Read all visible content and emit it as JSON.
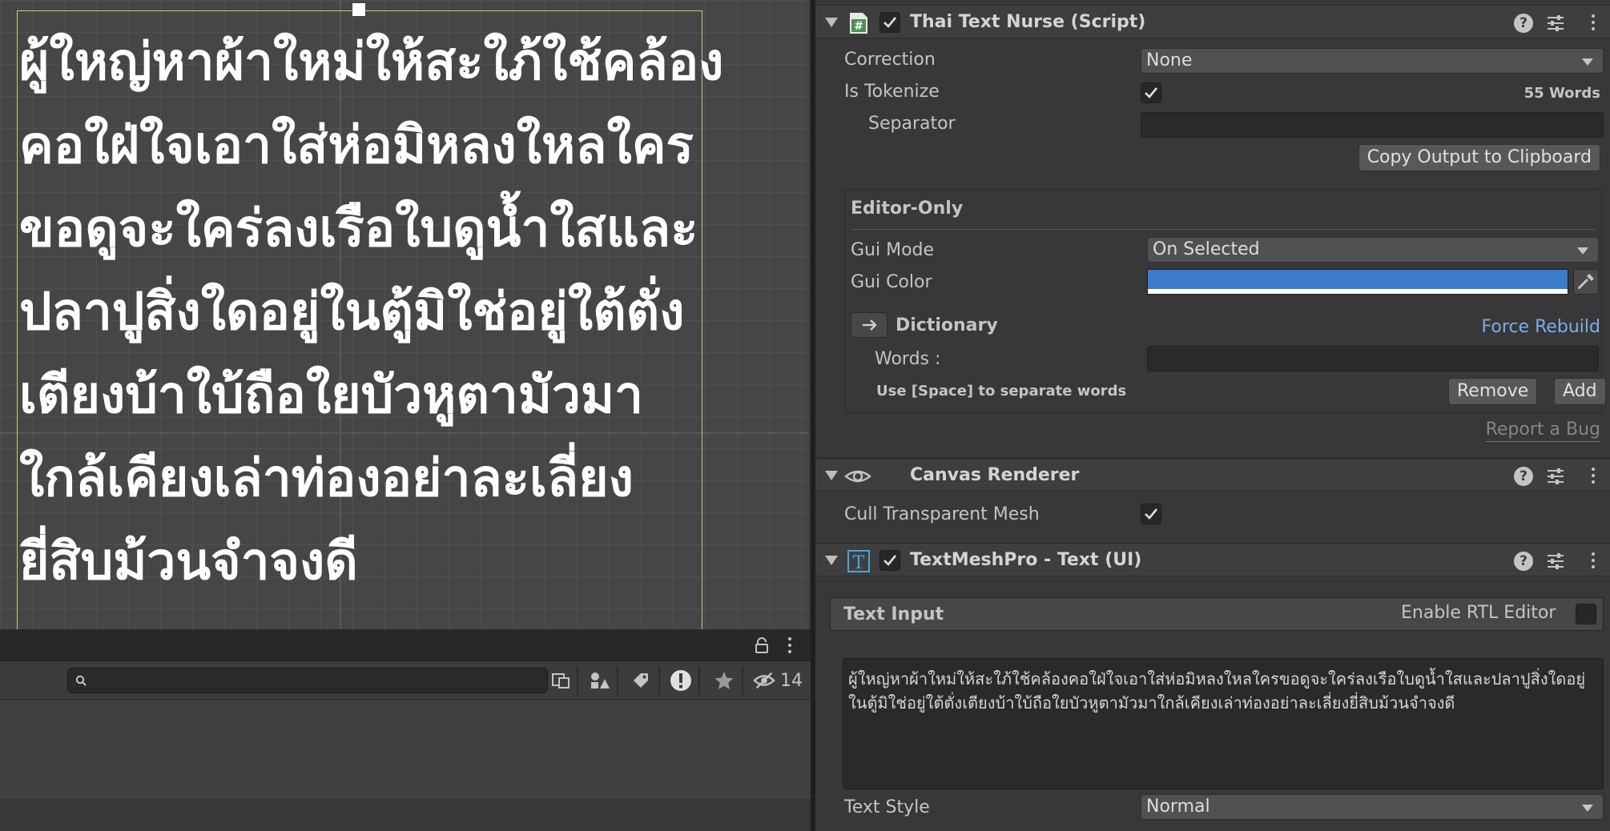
{
  "scene": {
    "text_lines": [
      "ผู้ใหญ่หาผ้าใหม่ให้สะใภ้ใช้คล้อง",
      "คอใฝ่ใจเอาใส่ห่อมิหลงใหลใคร",
      "ขอดูจะใคร่ลงเรือใบดูน้ำใสและ",
      "ปลาปูสิ่งใดอยู่ในตู้มิใช่อยู่ใต้ตั่ง",
      "เตียงบ้าใบ้ถือใยบัวหูตามัวมา",
      "ใกล้เคียงเล่าท่องอย่าละเลี่ยง",
      "ยี่สิบม้วนจำจงดี"
    ]
  },
  "project_pane": {
    "search": {
      "value": "",
      "placeholder": ""
    },
    "hidden_count": "14"
  },
  "inspector": {
    "thai_text_nurse": {
      "title": "Thai Text Nurse (Script)",
      "enabled": true,
      "correction_label": "Correction",
      "correction_value": "None",
      "is_tokenize_label": "Is Tokenize",
      "is_tokenize": true,
      "word_count": "55 Words",
      "separator_label": "Separator",
      "separator_value": "",
      "copy_button": "Copy Output to Clipboard",
      "editor_only": {
        "title": "Editor-Only",
        "gui_mode_label": "Gui Mode",
        "gui_mode_value": "On Selected",
        "gui_color_label": "Gui Color",
        "gui_color": "#3b7ccb",
        "dictionary_label": "Dictionary",
        "force_rebuild": "Force Rebuild",
        "words_label": "Words :",
        "words_value": "",
        "hint": "Use [Space] to separate words",
        "remove_button": "Remove",
        "add_button": "Add"
      },
      "report_bug": "Report a Bug"
    },
    "canvas_renderer": {
      "title": "Canvas Renderer",
      "cull_label": "Cull Transparent Mesh",
      "cull": true
    },
    "textmeshpro": {
      "title": "TextMeshPro - Text (UI)",
      "enabled": true,
      "text_input_label": "Text Input",
      "rtl_label": "Enable RTL Editor",
      "rtl_enabled": false,
      "text_input_value": "ผู้ใหญ่หาผ้าใหม่ให้สะใภ้ใช้คล้องคอใฝ่ใจเอาใส่ห่อมิหลงใหลใครขอดูจะใคร่ลงเรือใบดูน้ำใสและปลาปูสิ่งใดอยู่ในตู้มิใช่อยู่ใต้ตั่งเตียงบ้าใบ้ถือใยบัวหูตามัวมาใกล้เคียงเล่าท่องอย่าละเลี่ยงยี่สิบม้วนจำจงดี",
      "text_style_label": "Text Style",
      "text_style_value": "Normal"
    }
  },
  "colors": {
    "accent_link": "#7fa9ea",
    "gui_color": "#3b7ccb",
    "script_icon": "#4f8f4f"
  }
}
